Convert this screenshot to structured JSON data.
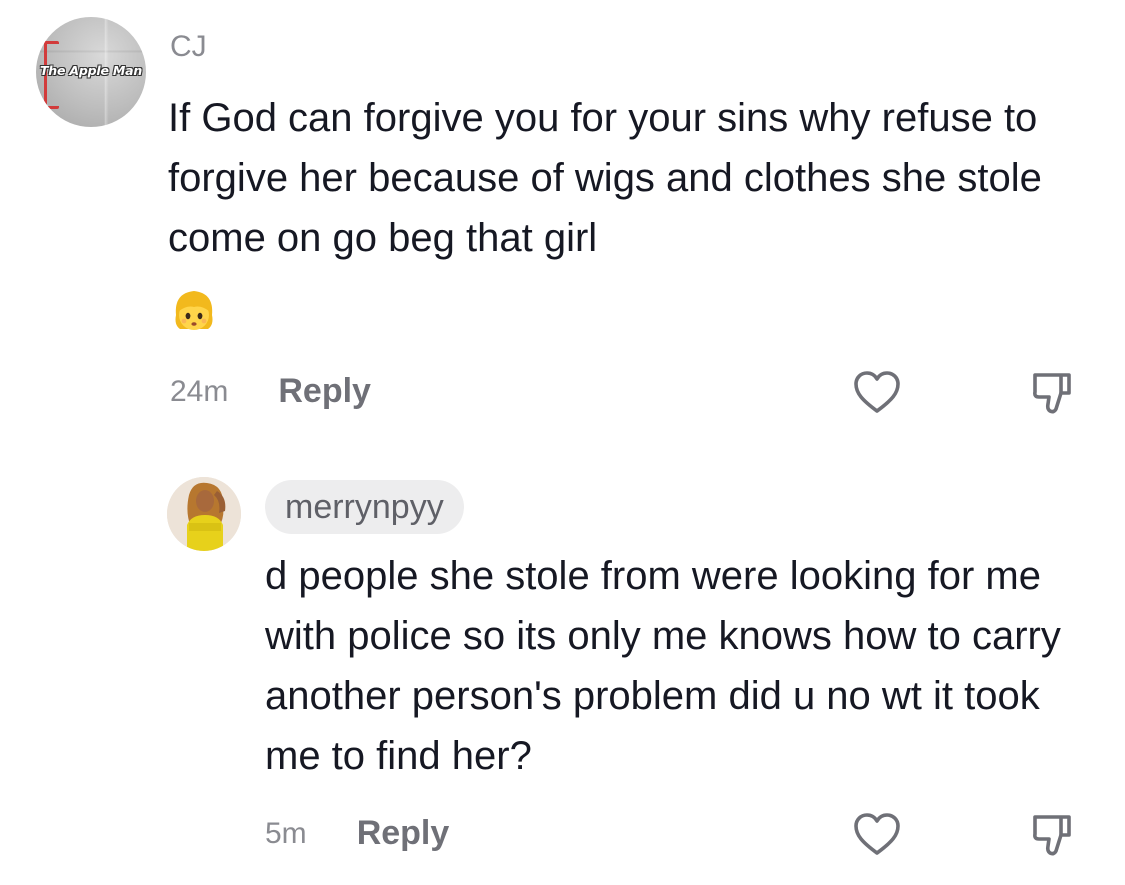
{
  "comments": [
    {
      "username": "CJ",
      "avatar_label": "The Apple Man",
      "text": "If God can forgive you for your sins why refuse to forgive her because of wigs and clothes she stole come on go beg that girl",
      "emoji": "👧",
      "time": "24m",
      "reply_label": "Reply"
    }
  ],
  "replies": [
    {
      "username": "merrynpyy",
      "text": "d people she stole from were looking for me with police so its only me knows how to carry another person's problem did u no wt it took me to find her?",
      "time": "5m",
      "reply_label": "Reply"
    }
  ],
  "icons": {
    "like": "heart-icon",
    "dislike": "thumbs-down-icon"
  },
  "colors": {
    "text": "#161823",
    "muted": "#8a8b91",
    "pill_bg": "#ededee"
  }
}
